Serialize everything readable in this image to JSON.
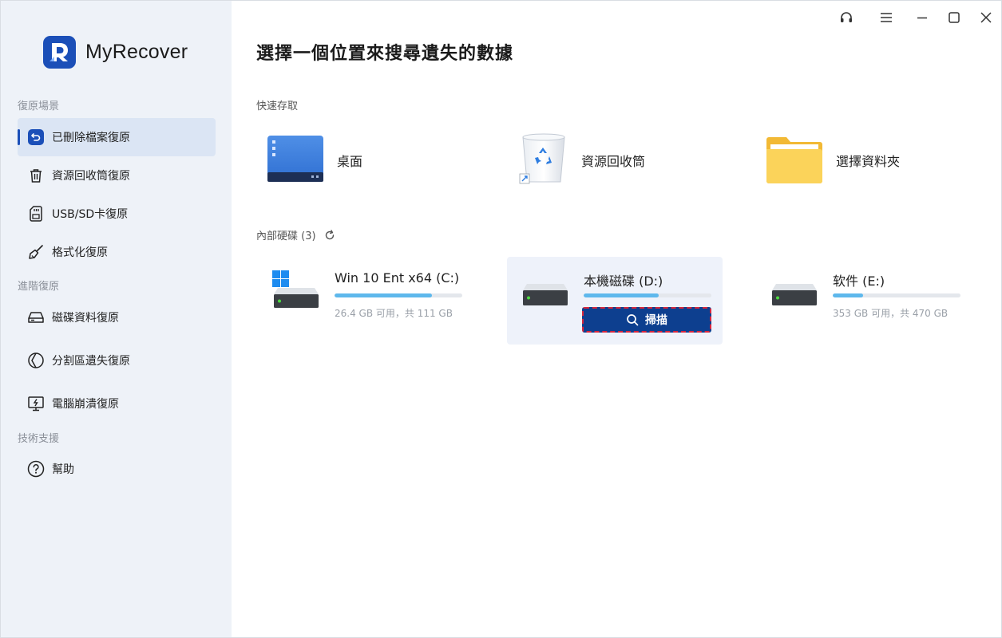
{
  "app": {
    "name": "MyRecover",
    "brand_color": "#1b4fb8"
  },
  "titlebar": {
    "icons": [
      "headset-icon",
      "menu-icon",
      "minimize-icon",
      "maximize-icon",
      "close-icon"
    ]
  },
  "sidebar": {
    "sections": [
      {
        "title": "復原場景",
        "items": [
          {
            "label": "已刪除檔案復原",
            "icon": "undo-icon",
            "active": true
          },
          {
            "label": "資源回收筒復原",
            "icon": "trash-icon"
          },
          {
            "label": "USB/SD卡復原",
            "icon": "sd-card-icon"
          },
          {
            "label": "格式化復原",
            "icon": "broom-icon"
          }
        ]
      },
      {
        "title": "進階復原",
        "items": [
          {
            "label": "磁碟資料復原",
            "icon": "hard-drive-icon"
          },
          {
            "label": "分割區遺失復原",
            "icon": "partition-icon"
          },
          {
            "label": "電腦崩潰復原",
            "icon": "monitor-crash-icon"
          }
        ]
      },
      {
        "title": "技術支援",
        "items": [
          {
            "label": "幫助",
            "icon": "help-icon"
          }
        ]
      }
    ]
  },
  "main": {
    "title": "選擇一個位置來搜尋遺失的數據",
    "quick_access": {
      "label": "快速存取",
      "items": [
        {
          "label": "桌面",
          "icon": "desktop-icon"
        },
        {
          "label": "資源回收筒",
          "icon": "recycle-bin-icon"
        },
        {
          "label": "選擇資料夾",
          "icon": "folder-icon"
        }
      ]
    },
    "disks": {
      "label": "內部硬碟 (3)",
      "items": [
        {
          "name": "Win 10 Ent x64 (C:)",
          "size": "26.4 GB 可用，共 111 GB",
          "used_fraction": 0.76
        },
        {
          "name": "本機磁碟 (D:)",
          "size": "",
          "used_fraction": 0.59,
          "scan_label": "掃描"
        },
        {
          "name": "软件 (E:)",
          "size": "353 GB 可用，共 470 GB",
          "used_fraction": 0.24
        }
      ]
    }
  }
}
